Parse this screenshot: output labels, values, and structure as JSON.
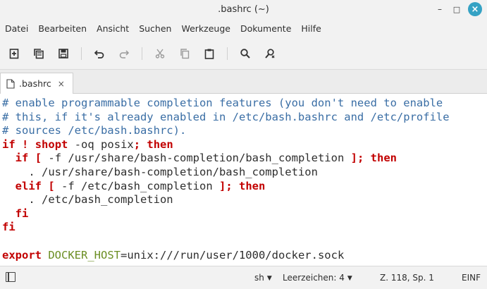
{
  "window": {
    "title": ".bashrc (~)"
  },
  "menu": [
    "Datei",
    "Bearbeiten",
    "Ansicht",
    "Suchen",
    "Werkzeuge",
    "Dokumente",
    "Hilfe"
  ],
  "toolbar": {
    "icons": [
      "new-document-icon",
      "copy-document-icon",
      "save-icon",
      "undo-icon",
      "redo-icon",
      "cut-icon",
      "copy-icon",
      "paste-icon",
      "search-icon",
      "replace-icon"
    ]
  },
  "tab": {
    "label": ".bashrc",
    "close": "×"
  },
  "editor": {
    "lines": [
      "# enable programmable completion features (you don't need to enable",
      "# this, if it's already enabled in /etc/bash.bashrc and /etc/profile",
      "# sources /etc/bash.bashrc).",
      "if ! shopt -oq posix; then",
      "  if [ -f /usr/share/bash-completion/bash_completion ]; then",
      "    . /usr/share/bash-completion/bash_completion",
      "  elif [ -f /etc/bash_completion ]; then",
      "    . /etc/bash_completion",
      "  fi",
      "fi",
      "",
      "export DOCKER_HOST=unix:///run/user/1000/docker.sock"
    ]
  },
  "status": {
    "language": "sh",
    "indent": "Leerzeichen: 4",
    "position": "Z. 118, Sp. 1",
    "mode": "EINF"
  },
  "colors": {
    "comment": "#3a6ea5",
    "keyword": "#c20000",
    "variable": "#6b8e23",
    "close_button": "#35a2c4"
  }
}
